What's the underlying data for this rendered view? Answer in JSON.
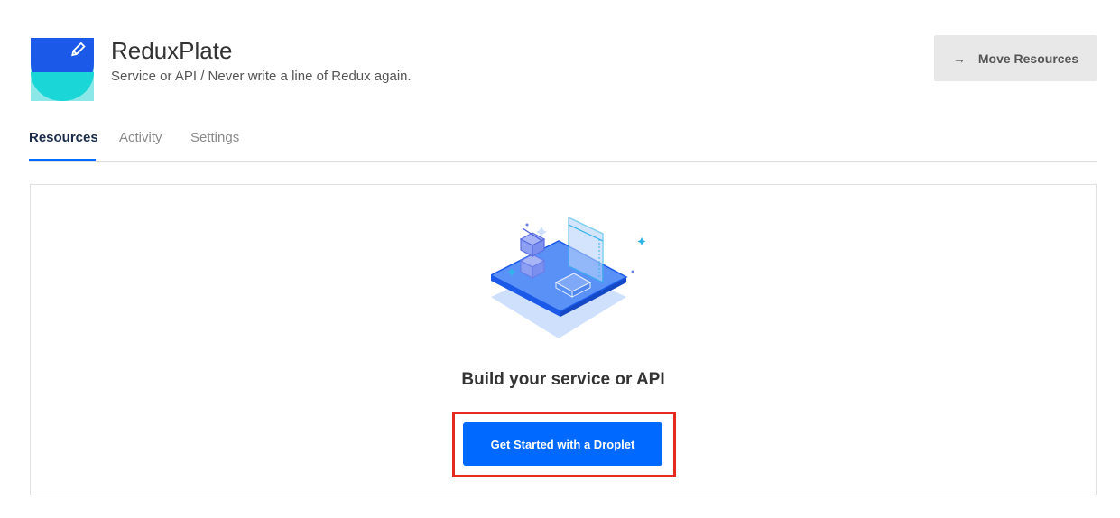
{
  "header": {
    "title": "ReduxPlate",
    "subtitle": "Service or API / Never write a line of Redux again.",
    "move_button_label": "Move Resources",
    "move_button_icon": "arrow-right-icon"
  },
  "tabs": [
    {
      "label": "Resources",
      "active": true
    },
    {
      "label": "Activity",
      "active": false
    },
    {
      "label": "Settings",
      "active": false
    }
  ],
  "empty_state": {
    "heading": "Build your service or API",
    "button_label": "Get Started with a Droplet"
  },
  "colors": {
    "accent": "#0069ff",
    "project_icon_top": "#1b5ae8",
    "project_icon_bottom": "#1ad6d6",
    "highlight": "#e52b1e"
  }
}
